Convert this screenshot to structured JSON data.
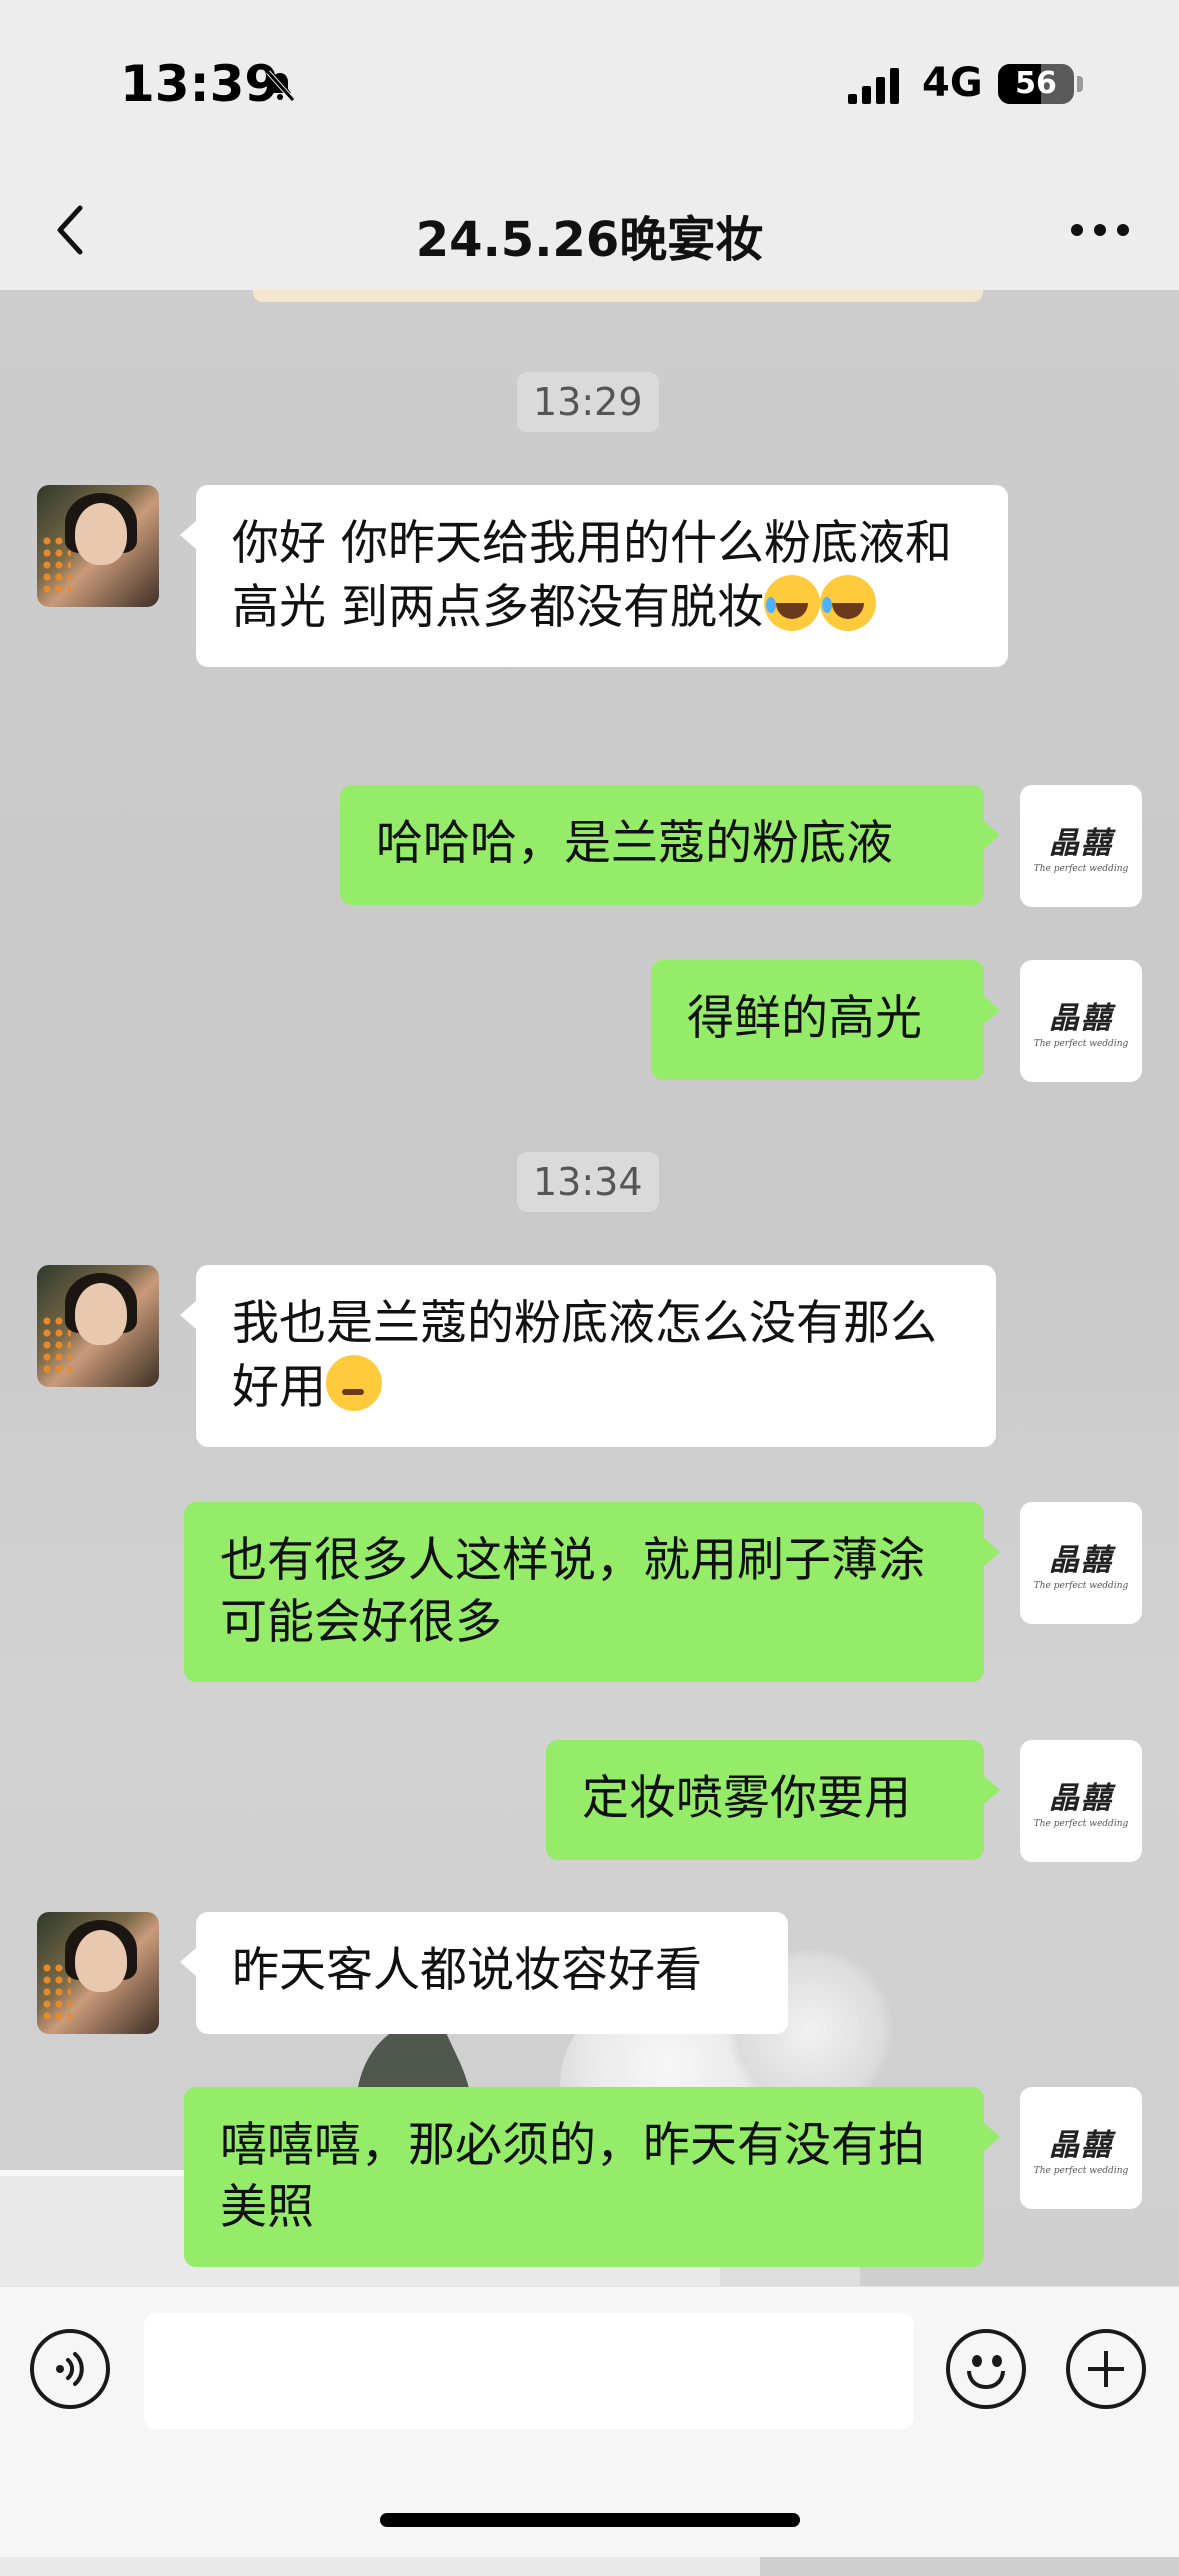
{
  "status_bar": {
    "time": "13:39",
    "network": "4G",
    "battery_level": "56",
    "battery_fraction": 0.56,
    "icons": [
      "bell-slash-icon",
      "signal-icon",
      "battery-icon"
    ]
  },
  "nav": {
    "title": "24.5.26晚宴妆",
    "back_icon": "chevron-left-icon",
    "more_icon": "more-dots-icon"
  },
  "timestamps": [
    "13:29",
    "13:34"
  ],
  "messages": [
    {
      "side": "left",
      "text": "你好 你昨天给我用的什么粉底液和高光  到两点多都没有脱妆",
      "emoji": "laughing-emoji"
    },
    {
      "side": "right",
      "text": "哈哈哈，是兰蔻的粉底液"
    },
    {
      "side": "right",
      "text": "得鲜的高光"
    },
    {
      "side": "left",
      "text": "我也是兰蔻的粉底液怎么没有那么好用",
      "emoji": "thinking-emoji"
    },
    {
      "side": "right",
      "text": "也有很多人这样说，就用刷子薄涂可能会好很多"
    },
    {
      "side": "right",
      "text": "定妆喷雾你要用"
    },
    {
      "side": "left",
      "text": "昨天客人都说妆容好看"
    },
    {
      "side": "right",
      "text": "嘻嘻嘻，那必须的，昨天有没有拍美照"
    }
  ],
  "avatar_right_logo": {
    "main": "晶囍",
    "sub": "The perfect wedding"
  },
  "input_bar": {
    "value": "",
    "voice_icon": "voice-icon",
    "emoji_icon": "smiley-icon",
    "plus_icon": "plus-circle-icon"
  },
  "colors": {
    "bubble_right": "#95ec69",
    "bubble_left": "#ffffff",
    "header_bg": "#ededed"
  }
}
